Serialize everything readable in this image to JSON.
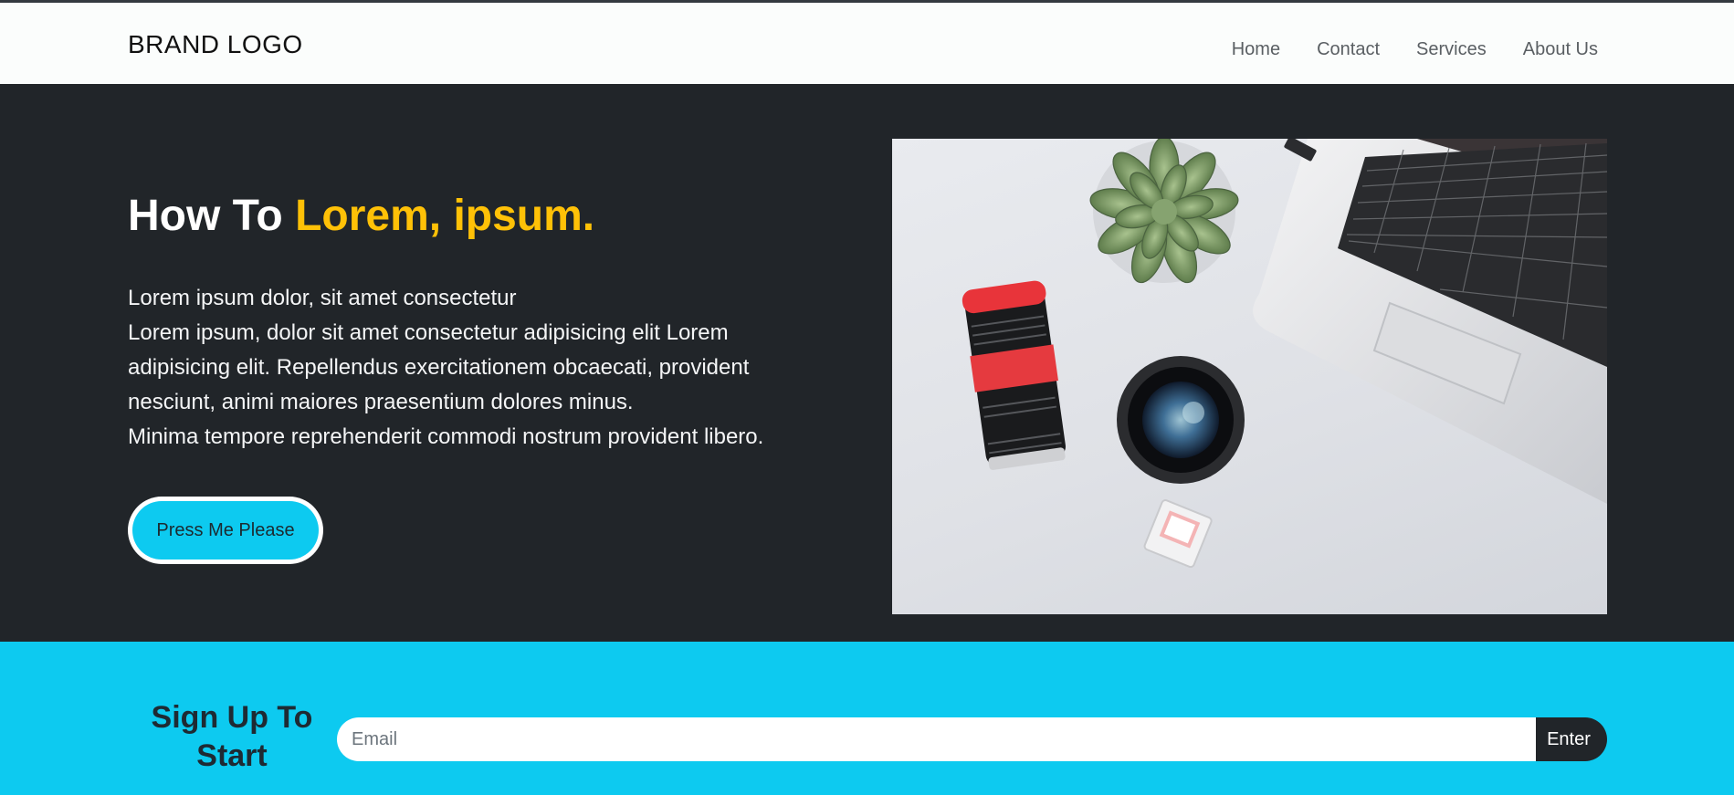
{
  "navbar": {
    "brand": "BRAND LOGO",
    "links": [
      "Home",
      "Contact",
      "Services",
      "About Us"
    ]
  },
  "hero": {
    "title_prefix": "How To ",
    "title_accent": "Lorem, ipsum.",
    "paragraph_lines": [
      "Lorem ipsum dolor, sit amet consectetur",
      "Lorem ipsum, dolor sit amet consectetur adipisicing elit Lorem adipisicing elit. Repellendus exercitationem obcaecati, provident nesciunt, animi maiores praesentium dolores minus.",
      "Minima tempore reprehenderit commodi nostrum provident libero."
    ],
    "button_label": "Press Me Please",
    "image_icon": "desk-photo-laptop-camera-lens-plant"
  },
  "signup": {
    "title": "Sign Up To Start",
    "email_placeholder": "Email",
    "button_label": "Enter"
  },
  "colors": {
    "dark": "#212529",
    "accent_yellow": "#ffc107",
    "accent_cyan": "#0dcaf0",
    "navbar_bg": "#fbfdfc"
  }
}
